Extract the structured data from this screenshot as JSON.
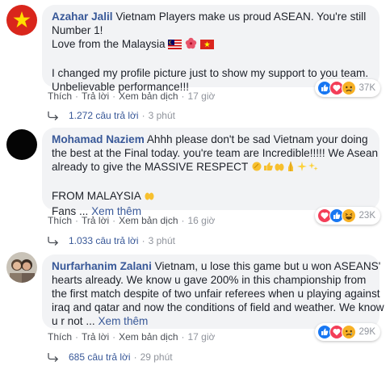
{
  "actions": {
    "like": "Thích",
    "reply": "Trả lời",
    "translate": "Xem bản dịch",
    "sep": "·"
  },
  "comments": [
    {
      "author": "Azahar Jalil",
      "lines": [
        "Vietnam Players make us proud ASEAN. You're still",
        "Number 1!",
        "Love from the Malaysia"
      ],
      "lines2": [
        "I changed my profile picture just to show my support to you team.",
        "Unbelievable performance!!!"
      ],
      "time": "17 giờ",
      "reaction_count": "37K",
      "replies": "1.272 câu trả lời",
      "replies_time": "3 phút"
    },
    {
      "author": "Mohamad Naziem",
      "lines": [
        "Ahhh please don't be sad Vietnam your doing",
        "the best at the Final today. you're team are Incredible!!!!! We Asean",
        "already to give the MASSIVE RESPECT"
      ],
      "lines2": [
        "FROM MALAYSIA"
      ],
      "fans": "Fans ...",
      "see_more": "Xem thêm",
      "time": "16 giờ",
      "reaction_count": "23K",
      "replies": "1.033 câu trả lời",
      "replies_time": "3 phút"
    },
    {
      "author": "Nurfarhanim Zalani",
      "lines": [
        "Vietnam, u lose this game but u won ASEANS'",
        "hearts already. We know u gave 200% in this championship from",
        "the first match despite of two unfair referees when u playing against",
        "iraq and qatar and now the conditions of field and weather. We know"
      ],
      "tail": "u r not ...",
      "see_more": "Xem thêm",
      "time": "17 giờ",
      "reaction_count": "29K",
      "replies": "685 câu trả lời",
      "replies_time": "29 phút"
    }
  ],
  "colors": {
    "link": "#385898",
    "bubble": "#f2f3f5",
    "meta": "#90949c",
    "like_blue": "#1877f2",
    "love_red": "#f33e58",
    "emoji_yellow": "#f7b125"
  },
  "icons": [
    "vietnam-flag-avatar",
    "black-avatar",
    "photo-avatar",
    "like-icon",
    "love-icon",
    "sad-icon",
    "haha-icon",
    "reply-arrow-icon"
  ]
}
